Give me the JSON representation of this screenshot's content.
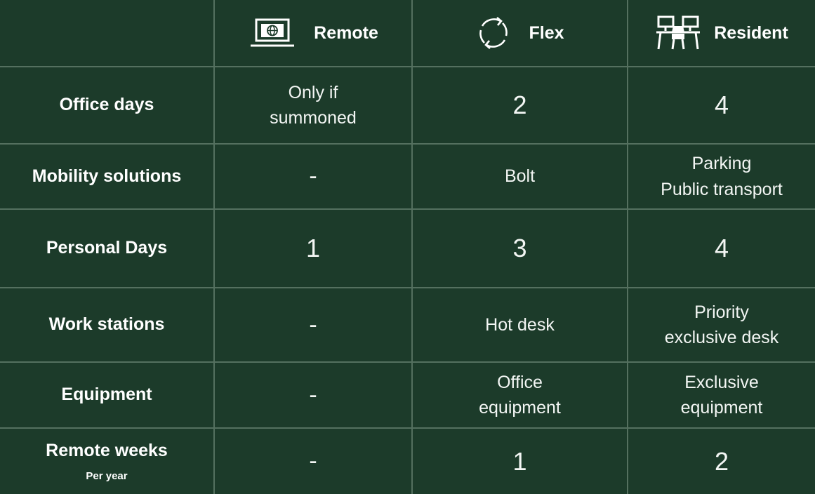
{
  "headers": [
    {
      "label": "Remote",
      "icon": "laptop-globe-icon"
    },
    {
      "label": "Flex",
      "icon": "refresh-cycle-icon"
    },
    {
      "label": "Resident",
      "icon": "office-desk-chair-icon"
    }
  ],
  "rows": [
    {
      "label": "Office days",
      "sub": "",
      "values": [
        "Only if\nsummoned",
        "2",
        "4"
      ]
    },
    {
      "label": "Mobility solutions",
      "sub": "",
      "values": [
        "-",
        "Bolt",
        "Parking\nPublic transport"
      ]
    },
    {
      "label": "Personal Days",
      "sub": "",
      "values": [
        "1",
        "3",
        "4"
      ]
    },
    {
      "label": "Work stations",
      "sub": "",
      "values": [
        "-",
        "Hot desk",
        "Priority\nexclusive desk"
      ]
    },
    {
      "label": "Equipment",
      "sub": "",
      "values": [
        "-",
        "Office\nequipment",
        "Exclusive\nequipment"
      ]
    },
    {
      "label": "Remote weeks",
      "sub": "Per year",
      "values": [
        "-",
        "1",
        "2"
      ]
    }
  ],
  "colors": {
    "background": "#1c3b2a",
    "divider": "#54705f",
    "text": "#ffffff"
  }
}
